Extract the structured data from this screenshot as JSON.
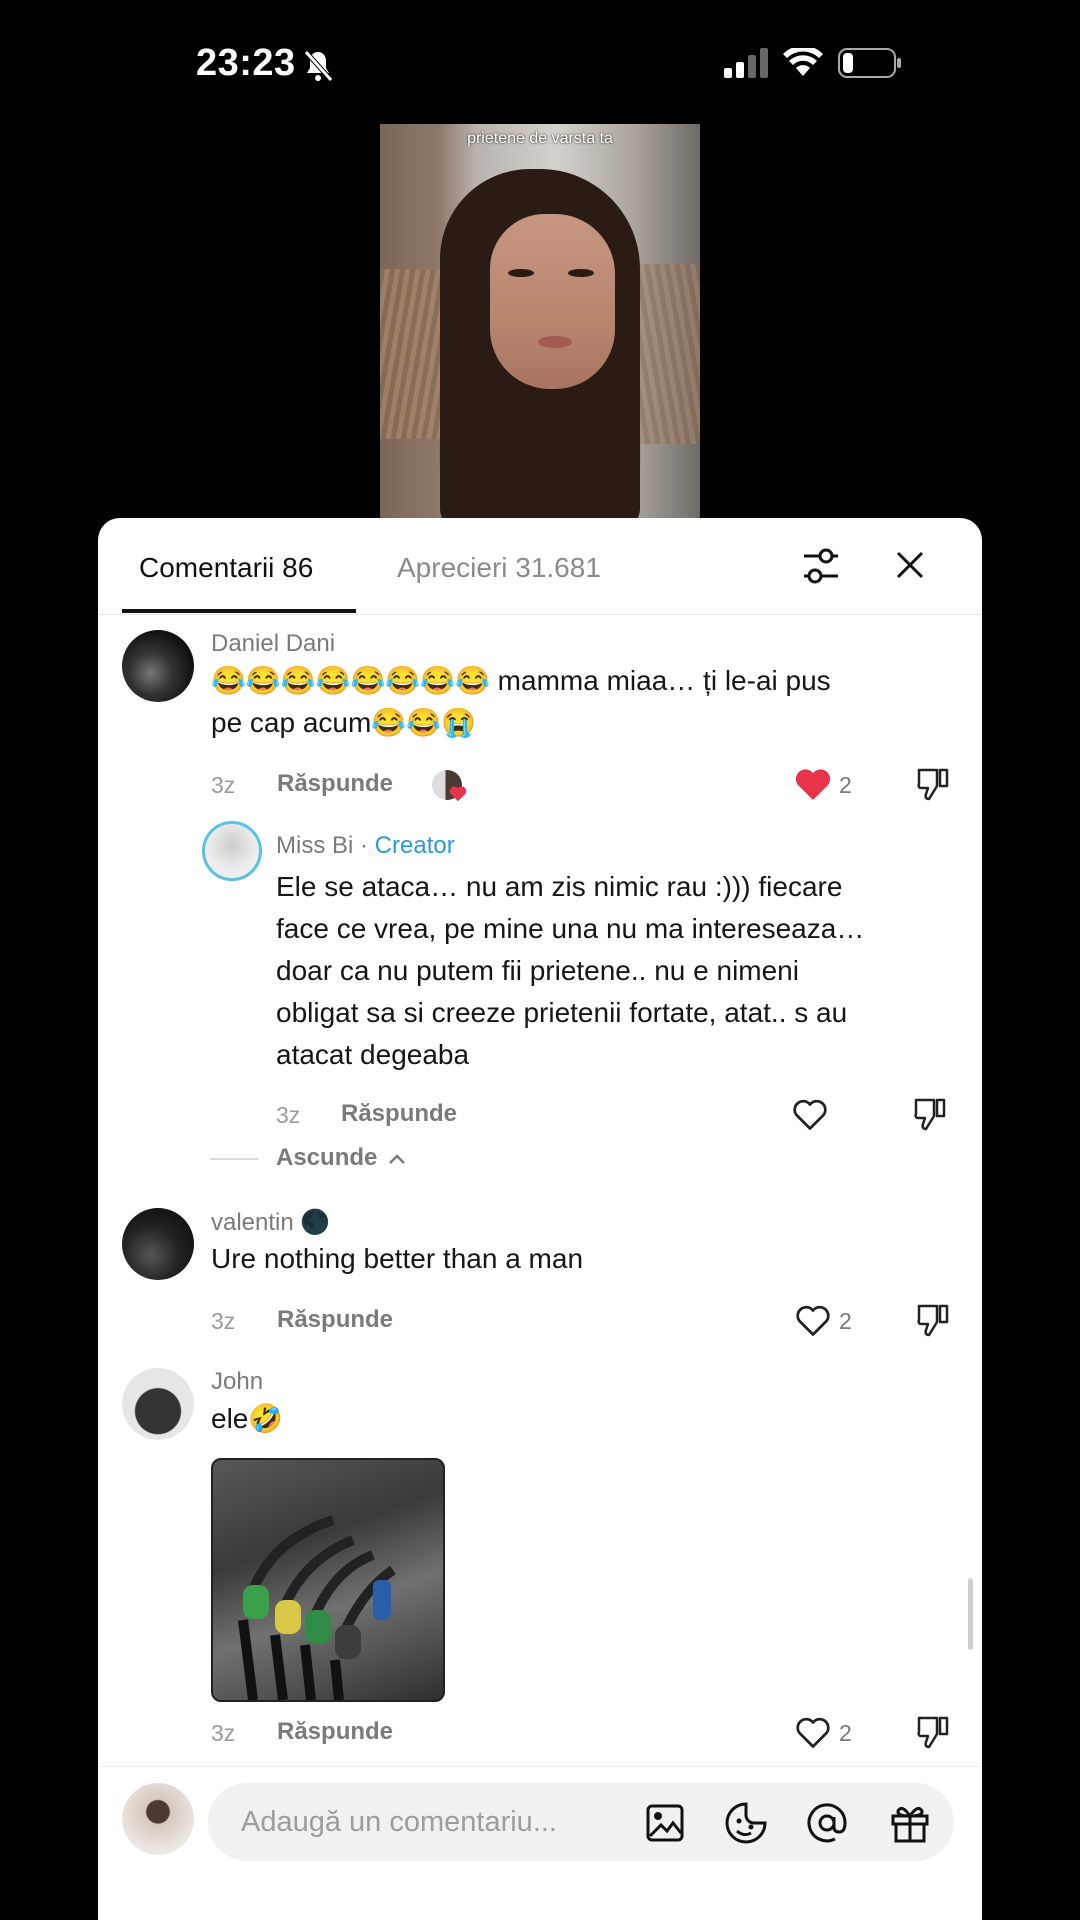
{
  "status_bar": {
    "time": "23:23"
  },
  "video": {
    "caption": "prietene de varsta ta"
  },
  "tabs": {
    "comments": "Comentarii 86",
    "likes": "Aprecieri 31.681"
  },
  "comments": [
    {
      "user": "Daniel Dani",
      "text_line1": "😂😂😂😂😂😂😂😂 mamma miaa… ți le-ai pus",
      "text_line2": "pe cap acum😂😂😭",
      "time": "3z",
      "reply": "Răspunde",
      "likes": "2",
      "liked": true
    },
    {
      "user": "Miss Bi",
      "creator_sep": " · ",
      "creator": "Creator",
      "lines": [
        "Ele se ataca… nu am zis nimic rau :))) fiecare",
        "face ce vrea, pe mine una nu ma intereseaza…",
        "doar ca nu putem fii prietene.. nu e nimeni",
        "obligat sa si creeze prietenii fortate, atat.. s au",
        "atacat degeaba"
      ],
      "time": "3z",
      "reply": "Răspunde"
    },
    {
      "user": "valentin",
      "user_suffix": "🌑",
      "text": "Ure nothing better than a man",
      "time": "3z",
      "reply": "Răspunde",
      "likes": "2"
    },
    {
      "user": "John",
      "text": "ele🤣",
      "time": "3z",
      "reply": "Răspunde",
      "likes": "2"
    }
  ],
  "hide_replies": "Ascunde",
  "input": {
    "placeholder": "Adaugă un comentariu..."
  },
  "colors": {
    "accent": "#e8344b",
    "creator": "#2b9bd6"
  },
  "icons": [
    "bell-off-icon",
    "signal-icon",
    "wifi-icon",
    "battery-icon",
    "filter-icon",
    "close-icon",
    "heart-icon",
    "dislike-icon",
    "image-icon",
    "emoji-icon",
    "mention-icon",
    "gift-icon"
  ]
}
